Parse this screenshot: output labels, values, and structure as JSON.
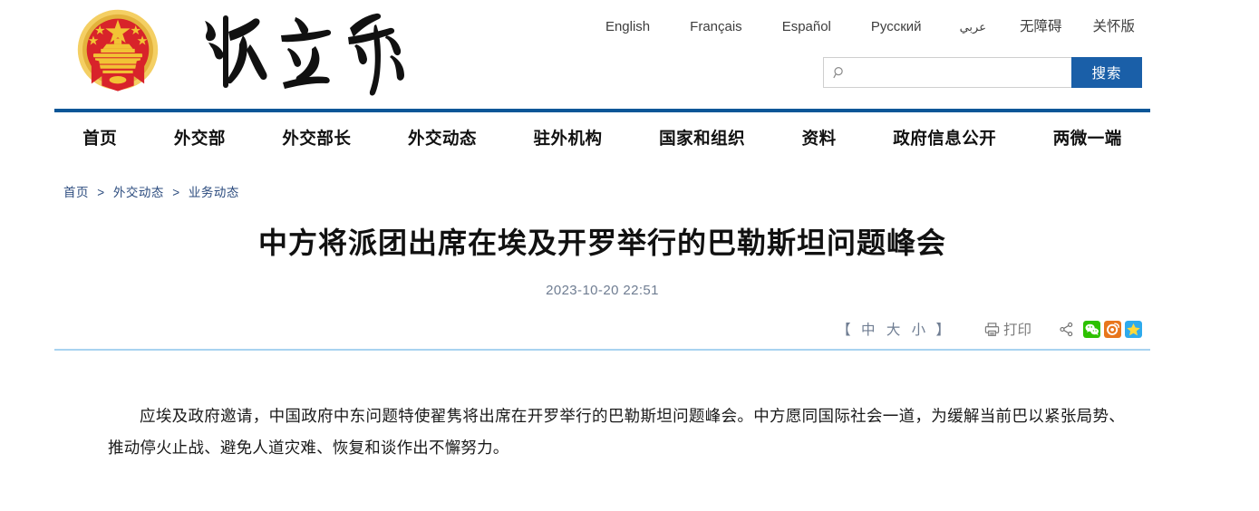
{
  "site": {
    "emblem_icon": "china-national-emblem",
    "wordmark_text": "外交部",
    "wordmark_icon": "mfa-calligraphy-wordmark"
  },
  "languages": [
    {
      "label": "English",
      "kind": "latin"
    },
    {
      "label": "Français",
      "kind": "latin"
    },
    {
      "label": "Español",
      "kind": "latin"
    },
    {
      "label": "Русский",
      "kind": "latin"
    },
    {
      "label": "عربي",
      "kind": "arabic"
    },
    {
      "label": "无障碍",
      "kind": "cjk"
    },
    {
      "label": "关怀版",
      "kind": "cjk"
    }
  ],
  "search": {
    "icon": "search-icon",
    "value": "",
    "placeholder": "",
    "button_label": "搜索"
  },
  "nav": {
    "items": [
      "首页",
      "外交部",
      "外交部长",
      "外交动态",
      "驻外机构",
      "国家和组织",
      "资料",
      "政府信息公开",
      "两微一端"
    ]
  },
  "breadcrumb": {
    "items": [
      "首页",
      "外交动态",
      "业务动态"
    ],
    "separator": ">"
  },
  "article": {
    "title": "中方将派团出席在埃及开罗举行的巴勒斯坦问题峰会",
    "published": "2023-10-20 22:51",
    "body": "应埃及政府邀请，中国政府中东问题特使翟隽将出席在开罗举行的巴勒斯坦问题峰会。中方愿同国际社会一道，为缓解当前巴以紧张局势、推动停火止战、避免人道灾难、恢复和谈作出不懈努力。"
  },
  "tools": {
    "fontsize_open": "【",
    "fontsize_close": "】",
    "fontsize_medium": "中",
    "fontsize_large": "大",
    "fontsize_small": "小",
    "print_label": "打印",
    "print_icon": "printer-icon",
    "share_icon": "share-nodes-icon",
    "social": [
      {
        "name": "wechat-icon",
        "label": "微信",
        "color": "#2dc100"
      },
      {
        "name": "weibo-icon",
        "label": "微博",
        "color": "#e8761c"
      },
      {
        "name": "qzone-icon",
        "label": "QQ空间",
        "color": "#2eaaec"
      }
    ]
  },
  "colors": {
    "brand_blue": "#0a5697",
    "button_blue": "#1a5fa8",
    "rule_light_blue": "#a8d3f0",
    "breadcrumb_blue": "#2b4b7e",
    "muted_gray": "#6f7d92"
  }
}
